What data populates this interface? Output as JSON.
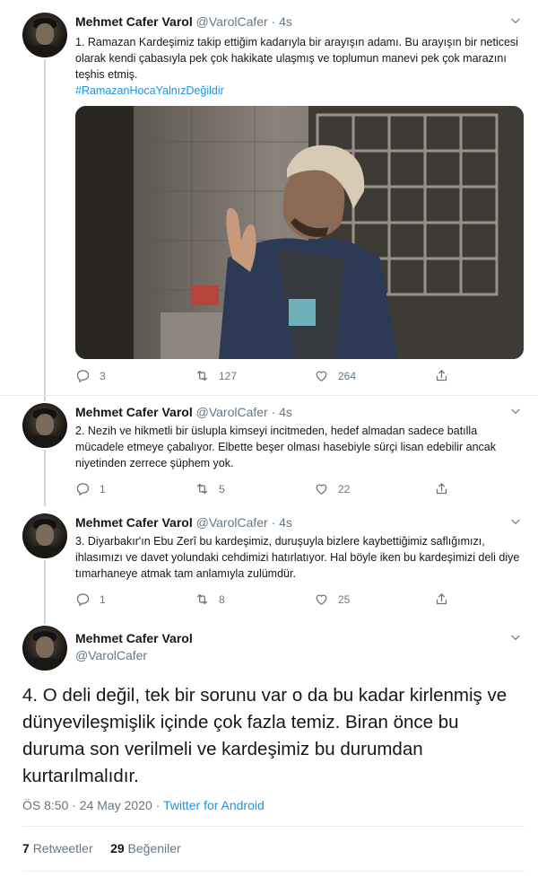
{
  "tweets": [
    {
      "name": "Mehmet Cafer Varol",
      "handle": "@VarolCafer",
      "time": "· 4s",
      "text": "1. Ramazan Kardeşimiz takip ettiğim kadarıyla bir arayışın adamı. Bu arayışın bir neticesi olarak kendi çabasıyla pek çok hakikate ulaşmış ve toplumun manevi pek çok marazını teşhis etmiş.",
      "hashtag": "#RamazanHocaYalnızDeğildir",
      "replies": "3",
      "retweets": "127",
      "likes": "264"
    },
    {
      "name": "Mehmet Cafer Varol",
      "handle": "@VarolCafer",
      "time": "· 4s",
      "text": "2. Nezih ve hikmetli bir üslupla kimseyi incitmeden, hedef almadan sadece batılla mücadele etmeye çabalıyor. Elbette beşer olması hasebiyle sürçi lisan edebilir ancak niyetinden zerrece şüphem yok.",
      "replies": "1",
      "retweets": "5",
      "likes": "22"
    },
    {
      "name": "Mehmet Cafer Varol",
      "handle": "@VarolCafer",
      "time": "· 4s",
      "text": "3. Diyarbakır'ın Ebu Zerî bu kardeşimiz, duruşuyla bizlere kaybettiğimiz saflığımızı, ihlasımızı ve davet yolundaki cehdimizi hatırlatıyor. Hal böyle iken bu kardeşimizi deli diye tımarhaneye atmak tam anlamıyla zulümdür.",
      "replies": "1",
      "retweets": "8",
      "likes": "25"
    }
  ],
  "main": {
    "name": "Mehmet Cafer Varol",
    "handle": "@VarolCafer",
    "text": "4. O deli değil, tek bir sorunu var o da bu kadar kirlenmiş ve dünyevileşmişlik içinde çok fazla temiz. Biran önce bu duruma son verilmeli ve kardeşimiz bu durumdan kurtarılmalıdır.",
    "time": "ÖS 8:50 · 24 May 2020 · ",
    "source": "Twitter for Android",
    "retweets_count": "7",
    "retweets_label": "Retweetler",
    "likes_count": "29",
    "likes_label": "Beğeniler"
  },
  "icons": {
    "reply": "reply-icon",
    "retweet": "retweet-icon",
    "like": "heart-icon",
    "share": "share-icon",
    "caret": "chevron-down-icon"
  },
  "colors": {
    "link": "#1b95e0",
    "muted": "#657786",
    "text": "#14171a",
    "divider": "#e6ecf0"
  }
}
